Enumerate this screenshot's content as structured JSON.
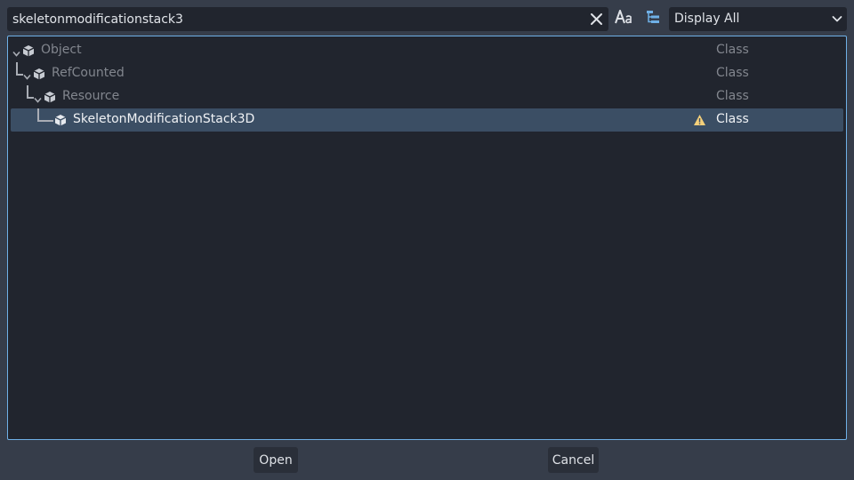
{
  "search": {
    "value": "skeletonmodificationstack3",
    "clear_icon": "close-icon"
  },
  "toolbar": {
    "case_icon": "match-case-icon",
    "tree_icon": "tree-view-icon"
  },
  "filter": {
    "selected": "Display All",
    "chevron_icon": "chevron-down-icon"
  },
  "tree": {
    "items": [
      {
        "name": "Object",
        "type": "Class",
        "depth": 0,
        "expanded": true,
        "selected": false,
        "warning": false
      },
      {
        "name": "RefCounted",
        "type": "Class",
        "depth": 1,
        "expanded": true,
        "selected": false,
        "warning": false
      },
      {
        "name": "Resource",
        "type": "Class",
        "depth": 2,
        "expanded": true,
        "selected": false,
        "warning": false
      },
      {
        "name": "SkeletonModificationStack3D",
        "type": "Class",
        "depth": 3,
        "expanded": false,
        "selected": true,
        "warning": true
      }
    ]
  },
  "buttons": {
    "open": "Open",
    "cancel": "Cancel"
  },
  "colors": {
    "background": "#363d4a",
    "panel": "#21252e",
    "accent_border": "#6fb0e6",
    "selection": "#3b4e64",
    "warning": "#f5d07a",
    "dim_text": "#82868e"
  }
}
